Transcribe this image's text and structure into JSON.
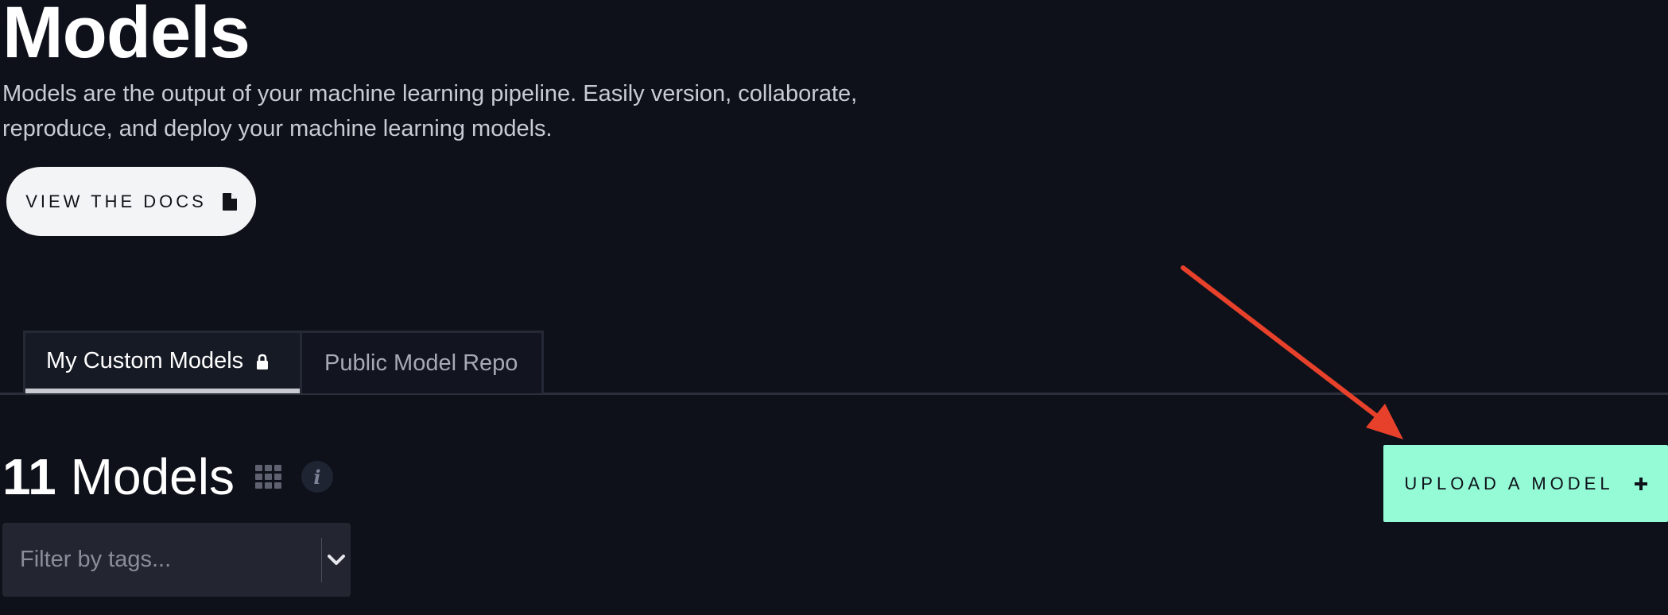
{
  "header": {
    "title": "Models",
    "description": "Models are the output of your machine learning pipeline. Easily version, collaborate, reproduce, and deploy your machine learning models.",
    "docs_button_label": "VIEW THE DOCS",
    "docs_icon": "document-icon"
  },
  "tabs": [
    {
      "label": "My Custom Models",
      "active": true,
      "icon": "lock-icon"
    },
    {
      "label": "Public Model Repo",
      "active": false
    }
  ],
  "models_summary": {
    "count": "11",
    "label": "Models",
    "view_icon": "grid-icon",
    "info_icon": "info-icon"
  },
  "upload_button": {
    "label": "UPLOAD A MODEL",
    "icon": "plus-icon"
  },
  "filter": {
    "placeholder": "Filter by tags...",
    "value": "",
    "dropdown_icon": "chevron-down-icon"
  },
  "annotation": {
    "arrow_color": "#e8412b",
    "arrow_target": "upload-a-model-button"
  },
  "colors": {
    "background": "#0e1119",
    "accent": "#94fbd6",
    "arrow": "#e8412b"
  }
}
